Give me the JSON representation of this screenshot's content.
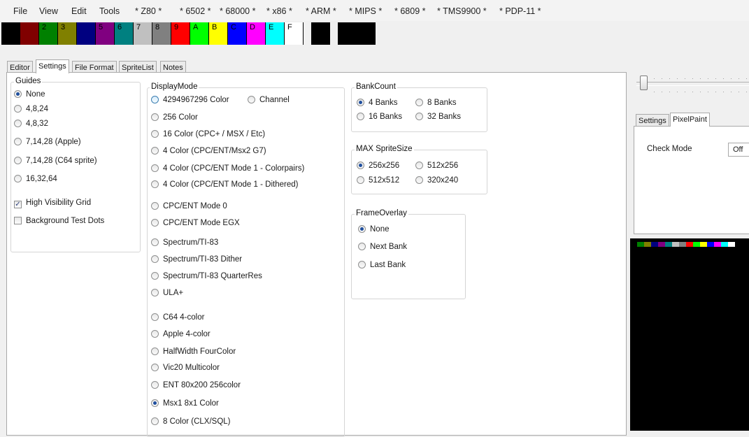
{
  "menu": {
    "items": [
      "File",
      "View",
      "Edit",
      "Tools",
      "* Z80 *",
      "* 6502 *",
      "* 68000 *",
      "* x86 *",
      "* ARM *",
      "* MIPS *",
      "* 6809 *",
      "* TMS9900 *",
      "* PDP-11 *"
    ]
  },
  "palette": {
    "swatches": [
      {
        "color": "#000000",
        "label": ""
      },
      {
        "color": "#800000",
        "label": ""
      },
      {
        "color": "#008000",
        "label": "2"
      },
      {
        "color": "#808000",
        "label": "3"
      },
      {
        "color": "#000080",
        "label": ""
      },
      {
        "color": "#800080",
        "label": "5"
      },
      {
        "color": "#008080",
        "label": "6"
      },
      {
        "color": "#c0c0c0",
        "label": "7"
      },
      {
        "color": "#808080",
        "label": "8"
      },
      {
        "color": "#ff0000",
        "label": "9"
      },
      {
        "color": "#00ff00",
        "label": "A"
      },
      {
        "color": "#ffff00",
        "label": "B"
      },
      {
        "color": "#0000ff",
        "label": "C"
      },
      {
        "color": "#ff00ff",
        "label": "D"
      },
      {
        "color": "#00ffff",
        "label": "E"
      },
      {
        "color": "#ffffff",
        "label": "F"
      },
      {
        "color": "#000000",
        "label": ""
      },
      {
        "color": "#000000",
        "label": ""
      },
      {
        "color": "#000000",
        "label": ""
      }
    ]
  },
  "tabs": {
    "main": [
      "Editor",
      "Settings",
      "File Format",
      "SpriteList",
      "Notes"
    ],
    "side": [
      "Settings",
      "PixelPaint"
    ]
  },
  "guides": {
    "title": "Guides",
    "options": [
      "None",
      "4,8,24",
      "4,8,32",
      "7,14,28 (Apple)",
      "7,14,28 (C64 sprite)",
      "16,32,64"
    ],
    "checkboxes": [
      "High Visibility Grid",
      "Background Test Dots"
    ]
  },
  "display_mode": {
    "title": "DisplayMode",
    "options": [
      "4294967296 Color",
      "Channel",
      "256 Color",
      "16 Color (CPC+ / MSX / Etc)",
      "4 Color (CPC/ENT/Msx2 G7)",
      "4 Color (CPC/ENT Mode 1 - Colorpairs)",
      "4 Color (CPC/ENT Mode 1 - Dithered)",
      "CPC/ENT Mode 0",
      "CPC/ENT Mode EGX",
      "Spectrum/TI-83",
      "Spectrum/TI-83 Dither",
      "Spectrum/TI-83 QuarterRes",
      "ULA+",
      "C64 4-color",
      "Apple 4-color",
      "HalfWidth FourColor",
      "Vic20 Multicolor",
      "ENT 80x200 256color",
      "Msx1 8x1 Color",
      "8 Color (CLX/SQL)"
    ]
  },
  "bank_count": {
    "title": "BankCount",
    "options": [
      "4 Banks",
      "8 Banks",
      "16 Banks",
      "32 Banks"
    ]
  },
  "max_sprite_size": {
    "title": "MAX SpriteSize",
    "options": [
      "256x256",
      "512x256",
      "512x512",
      "320x240"
    ]
  },
  "frame_overlay": {
    "title": "FrameOverlay",
    "options": [
      "None",
      "Next Bank",
      "Last Bank"
    ]
  },
  "pixel_paint": {
    "check_mode_label": "Check Mode",
    "check_mode_value": "Off"
  },
  "preview_strip": [
    "#000000",
    "#008000",
    "#808000",
    "#000080",
    "#800080",
    "#008080",
    "#c0c0c0",
    "#808080",
    "#ff0000",
    "#00ff00",
    "#ffff00",
    "#0000ff",
    "#ff00ff",
    "#00ffff",
    "#ffffff"
  ]
}
